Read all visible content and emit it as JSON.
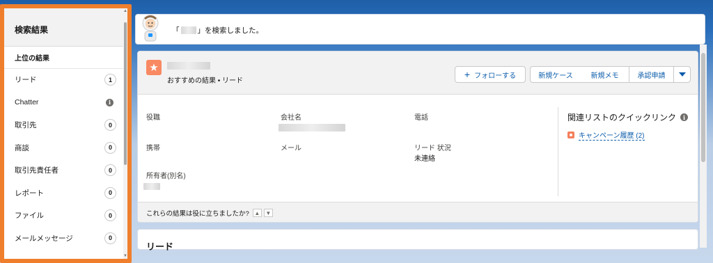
{
  "sidebar": {
    "title": "検索結果",
    "top_results": "上位の結果",
    "items": [
      {
        "label": "リード",
        "count": "1"
      },
      {
        "label": "Chatter",
        "count": "i"
      },
      {
        "label": "取引先",
        "count": "0"
      },
      {
        "label": "商談",
        "count": "0"
      },
      {
        "label": "取引先責任者",
        "count": "0"
      },
      {
        "label": "レポート",
        "count": "0"
      },
      {
        "label": "ファイル",
        "count": "0"
      },
      {
        "label": "メールメッセージ",
        "count": "0"
      }
    ]
  },
  "banner": {
    "prefix": "「",
    "suffix": "」を検索しました。"
  },
  "record": {
    "subtitle": "おすすめの結果 • リード",
    "follow_label": "フォローする",
    "buttons": [
      "新規ケース",
      "新規メモ",
      "承認申請"
    ],
    "fields": {
      "title_label": "役職",
      "company_label": "会社名",
      "phone_label": "電話",
      "mobile_label": "携帯",
      "email_label": "メール",
      "status_label": "リード 状況",
      "status_value": "未連絡",
      "owner_label": "所有者(別名)"
    },
    "quick_links_title": "関連リストのクイックリンク",
    "campaign_link": "キャンペーン履歴 (2)",
    "feedback_text": "これらの結果は役に立ちましたか?"
  },
  "section2": {
    "title": "リード"
  },
  "colors": {
    "accent_orange": "#f07f2d",
    "link_blue": "#0b5cab",
    "lead_icon": "#f88962"
  },
  "icons": [
    "astro-mascot-icon",
    "lead-icon",
    "plus-icon",
    "caret-down-icon",
    "info-icon",
    "campaign-icon",
    "thumbs-up-icon",
    "thumbs-down-icon"
  ]
}
